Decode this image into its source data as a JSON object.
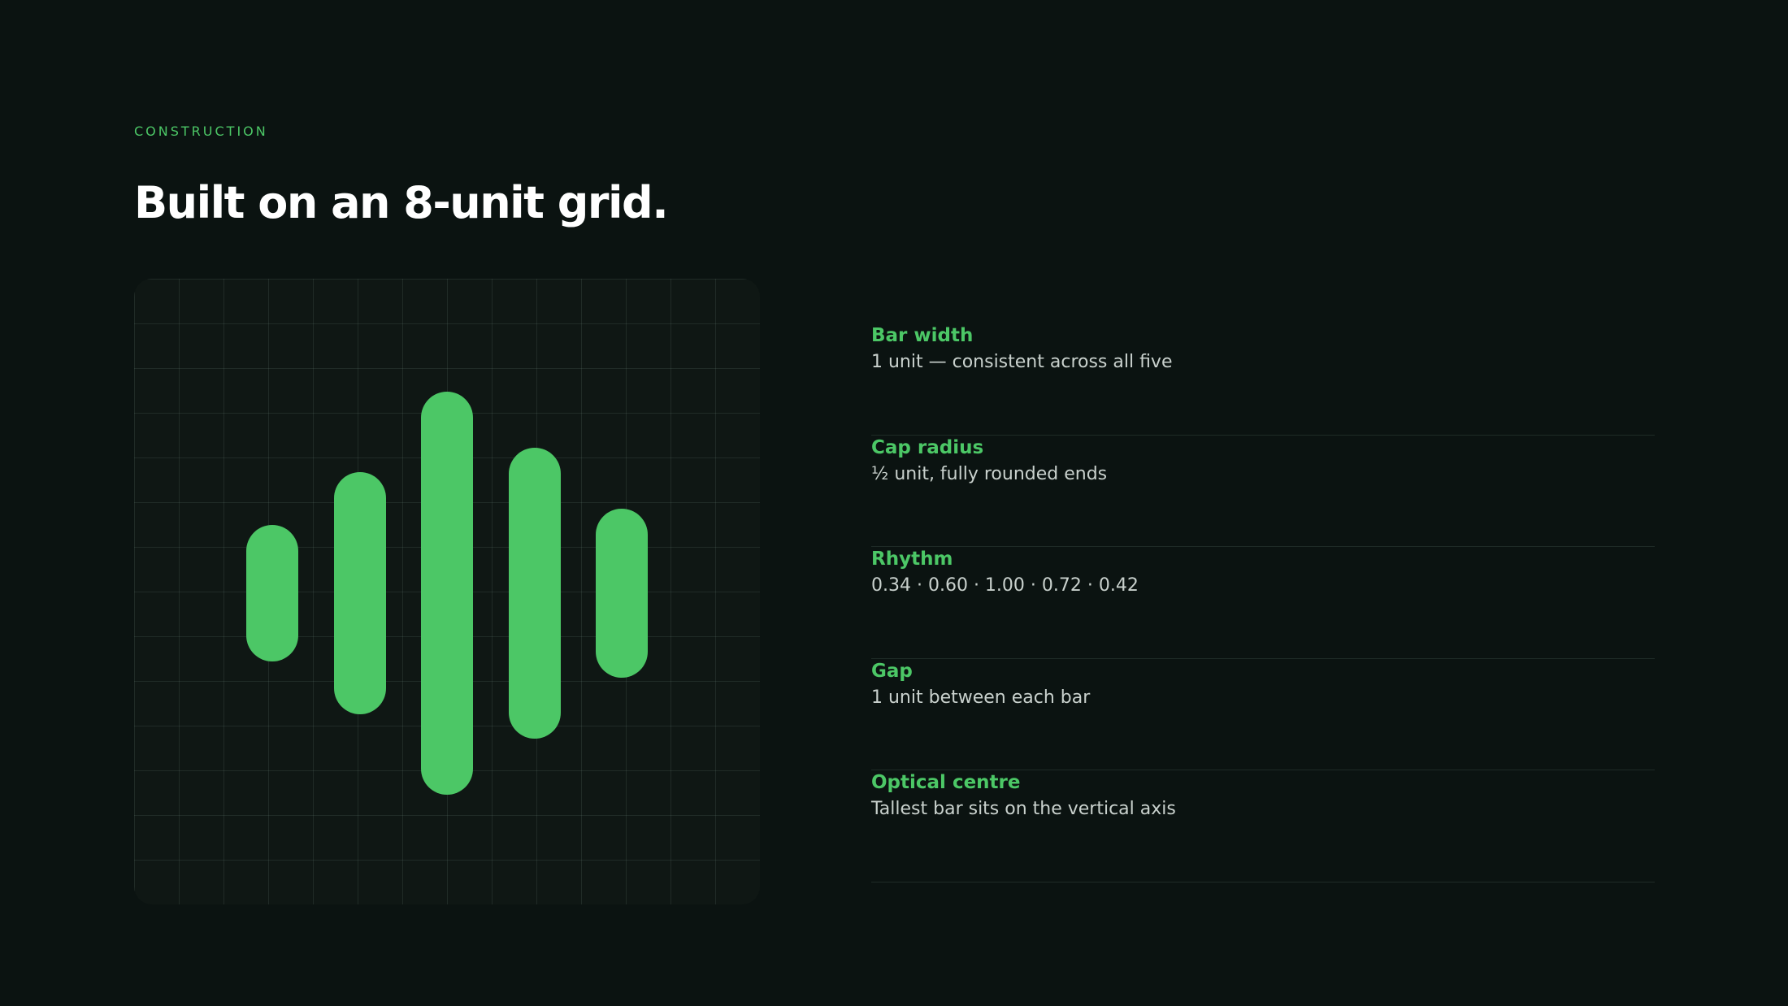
{
  "eyebrow": "CONSTRUCTION",
  "title": "Built on an 8-unit grid.",
  "colors": {
    "background": "#0b1311",
    "accent": "#4cc766",
    "text": "#ffffff",
    "muted_text": "#c9d1cd"
  },
  "diagram": {
    "grid_columns": 14,
    "grid_rows": 14,
    "bar_heights": [
      0.34,
      0.6,
      1.0,
      0.72,
      0.42
    ]
  },
  "specs": [
    {
      "label": "Bar width",
      "value": "1 unit — consistent across all five"
    },
    {
      "label": "Cap radius",
      "value": "½ unit, fully rounded ends"
    },
    {
      "label": "Rhythm",
      "value": "0.34 · 0.60 · 1.00 · 0.72 · 0.42"
    },
    {
      "label": "Gap",
      "value": "1 unit between each bar"
    },
    {
      "label": "Optical centre",
      "value": "Tallest bar sits on the vertical axis"
    }
  ]
}
